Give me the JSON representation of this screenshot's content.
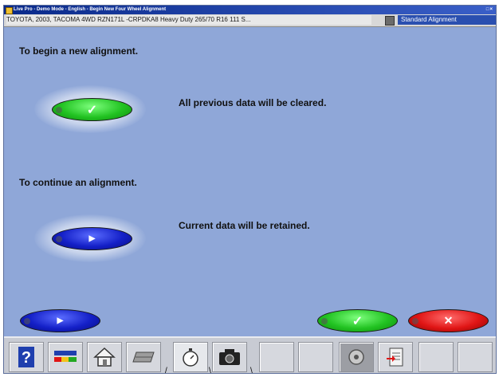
{
  "window": {
    "title": "Live Pro - Demo Mode - English - Begin New Four Wheel Alignment",
    "controls": "□×"
  },
  "infobar": {
    "vehicle": "TOYOTA, 2003, TACOMA 4WD RZN171L -CRPDKA8 Heavy Duty 265/70 R16 111 S...",
    "mode": "Standard Alignment"
  },
  "main": {
    "new_heading": "To begin a new alignment.",
    "new_desc": "All previous data will be cleared.",
    "continue_heading": "To continue an alignment.",
    "continue_desc": "Current data will be retained."
  },
  "colors": {
    "background": "#8fa7d8",
    "green": "#22c322",
    "blue": "#1420c8",
    "red": "#e01515"
  },
  "icons": {
    "new": "check-icon",
    "continue": "play-icon",
    "back": "play-icon",
    "confirm": "check-icon",
    "cancel": "close-icon"
  },
  "toolbar": {
    "buttons": [
      "help-icon",
      "flag-icon",
      "home-icon",
      "tray-icon",
      "stopwatch-icon",
      "camera-icon",
      "empty",
      "empty",
      "wheel-icon",
      "clipboard-icon",
      "empty",
      "empty"
    ]
  }
}
